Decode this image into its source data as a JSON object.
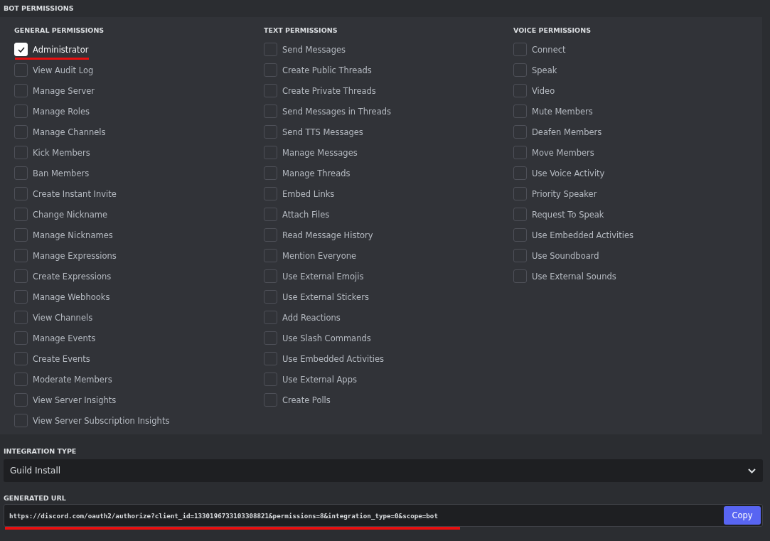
{
  "bot_permissions": {
    "title": "BOT PERMISSIONS",
    "columns": [
      {
        "heading": "GENERAL PERMISSIONS",
        "items": [
          {
            "label": "Administrator",
            "checked": true,
            "underlined": true
          },
          {
            "label": "View Audit Log",
            "checked": false,
            "underlined": false
          },
          {
            "label": "Manage Server",
            "checked": false,
            "underlined": false
          },
          {
            "label": "Manage Roles",
            "checked": false,
            "underlined": false
          },
          {
            "label": "Manage Channels",
            "checked": false,
            "underlined": false
          },
          {
            "label": "Kick Members",
            "checked": false,
            "underlined": false
          },
          {
            "label": "Ban Members",
            "checked": false,
            "underlined": false
          },
          {
            "label": "Create Instant Invite",
            "checked": false,
            "underlined": false
          },
          {
            "label": "Change Nickname",
            "checked": false,
            "underlined": false
          },
          {
            "label": "Manage Nicknames",
            "checked": false,
            "underlined": false
          },
          {
            "label": "Manage Expressions",
            "checked": false,
            "underlined": false
          },
          {
            "label": "Create Expressions",
            "checked": false,
            "underlined": false
          },
          {
            "label": "Manage Webhooks",
            "checked": false,
            "underlined": false
          },
          {
            "label": "View Channels",
            "checked": false,
            "underlined": false
          },
          {
            "label": "Manage Events",
            "checked": false,
            "underlined": false
          },
          {
            "label": "Create Events",
            "checked": false,
            "underlined": false
          },
          {
            "label": "Moderate Members",
            "checked": false,
            "underlined": false
          },
          {
            "label": "View Server Insights",
            "checked": false,
            "underlined": false
          },
          {
            "label": "View Server Subscription Insights",
            "checked": false,
            "underlined": false
          }
        ]
      },
      {
        "heading": "TEXT PERMISSIONS",
        "items": [
          {
            "label": "Send Messages",
            "checked": false,
            "underlined": false
          },
          {
            "label": "Create Public Threads",
            "checked": false,
            "underlined": false
          },
          {
            "label": "Create Private Threads",
            "checked": false,
            "underlined": false
          },
          {
            "label": "Send Messages in Threads",
            "checked": false,
            "underlined": false
          },
          {
            "label": "Send TTS Messages",
            "checked": false,
            "underlined": false
          },
          {
            "label": "Manage Messages",
            "checked": false,
            "underlined": false
          },
          {
            "label": "Manage Threads",
            "checked": false,
            "underlined": false
          },
          {
            "label": "Embed Links",
            "checked": false,
            "underlined": false
          },
          {
            "label": "Attach Files",
            "checked": false,
            "underlined": false
          },
          {
            "label": "Read Message History",
            "checked": false,
            "underlined": false
          },
          {
            "label": "Mention Everyone",
            "checked": false,
            "underlined": false
          },
          {
            "label": "Use External Emojis",
            "checked": false,
            "underlined": false
          },
          {
            "label": "Use External Stickers",
            "checked": false,
            "underlined": false
          },
          {
            "label": "Add Reactions",
            "checked": false,
            "underlined": false
          },
          {
            "label": "Use Slash Commands",
            "checked": false,
            "underlined": false
          },
          {
            "label": "Use Embedded Activities",
            "checked": false,
            "underlined": false
          },
          {
            "label": "Use External Apps",
            "checked": false,
            "underlined": false
          },
          {
            "label": "Create Polls",
            "checked": false,
            "underlined": false
          }
        ]
      },
      {
        "heading": "VOICE PERMISSIONS",
        "items": [
          {
            "label": "Connect",
            "checked": false,
            "underlined": false
          },
          {
            "label": "Speak",
            "checked": false,
            "underlined": false
          },
          {
            "label": "Video",
            "checked": false,
            "underlined": false
          },
          {
            "label": "Mute Members",
            "checked": false,
            "underlined": false
          },
          {
            "label": "Deafen Members",
            "checked": false,
            "underlined": false
          },
          {
            "label": "Move Members",
            "checked": false,
            "underlined": false
          },
          {
            "label": "Use Voice Activity",
            "checked": false,
            "underlined": false
          },
          {
            "label": "Priority Speaker",
            "checked": false,
            "underlined": false
          },
          {
            "label": "Request To Speak",
            "checked": false,
            "underlined": false
          },
          {
            "label": "Use Embedded Activities",
            "checked": false,
            "underlined": false
          },
          {
            "label": "Use Soundboard",
            "checked": false,
            "underlined": false
          },
          {
            "label": "Use External Sounds",
            "checked": false,
            "underlined": false
          }
        ]
      }
    ]
  },
  "integration_type": {
    "label": "INTEGRATION TYPE",
    "value": "Guild Install"
  },
  "generated_url": {
    "label": "GENERATED URL",
    "value": "https://discord.com/oauth2/authorize?client_id=1330196733103308821&permissions=8&integration_type=0&scope=bot",
    "underlined": true,
    "button": "Copy"
  }
}
